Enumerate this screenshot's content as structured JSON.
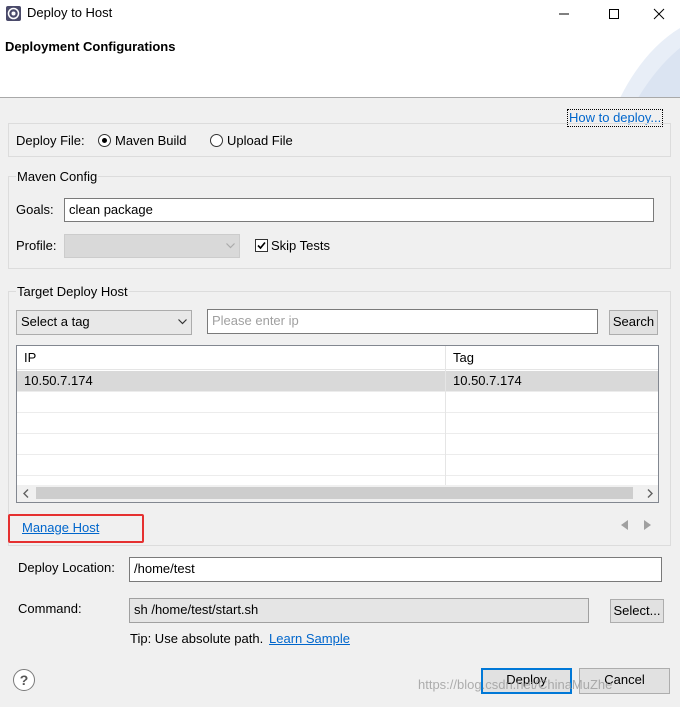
{
  "window": {
    "title": "Deploy to Host",
    "minimize_icon": "minimize-icon",
    "maximize_icon": "maximize-icon",
    "close_icon": "close-icon"
  },
  "header": {
    "title": "Deployment Configurations"
  },
  "howto_link": "How to deploy...",
  "deploy_file": {
    "label": "Deploy File:",
    "options": [
      {
        "label": "Maven Build",
        "selected": true
      },
      {
        "label": "Upload File",
        "selected": false
      }
    ]
  },
  "maven_config": {
    "group_label": "Maven Config",
    "goals_label": "Goals:",
    "goals_value": "clean package",
    "profile_label": "Profile:",
    "profile_value": "",
    "skip_tests_label": "Skip Tests",
    "skip_tests_checked": true
  },
  "target_host": {
    "group_label": "Target Deploy Host",
    "tag_select_value": "Select a tag",
    "ip_placeholder": "Please enter ip",
    "search_button": "Search",
    "table": {
      "columns": [
        "IP",
        "Tag"
      ],
      "rows": [
        {
          "ip": "10.50.7.174",
          "tag": "10.50.7.174",
          "selected": true
        }
      ]
    },
    "manage_host_link": "Manage Host"
  },
  "deploy_location": {
    "label": "Deploy Location:",
    "value": "/home/test"
  },
  "command": {
    "label": "Command:",
    "value": "sh /home/test/start.sh",
    "select_button": "Select..."
  },
  "tip": {
    "text": "Tip: Use absolute path.",
    "link": "Learn Sample"
  },
  "footer": {
    "deploy_button": "Deploy",
    "cancel_button": "Cancel",
    "watermark": "https://blog.csdn.net/ChinaMuZhe"
  },
  "colors": {
    "link": "#0066cc",
    "highlight_border": "#e53030",
    "default_button_border": "#0078d7"
  }
}
